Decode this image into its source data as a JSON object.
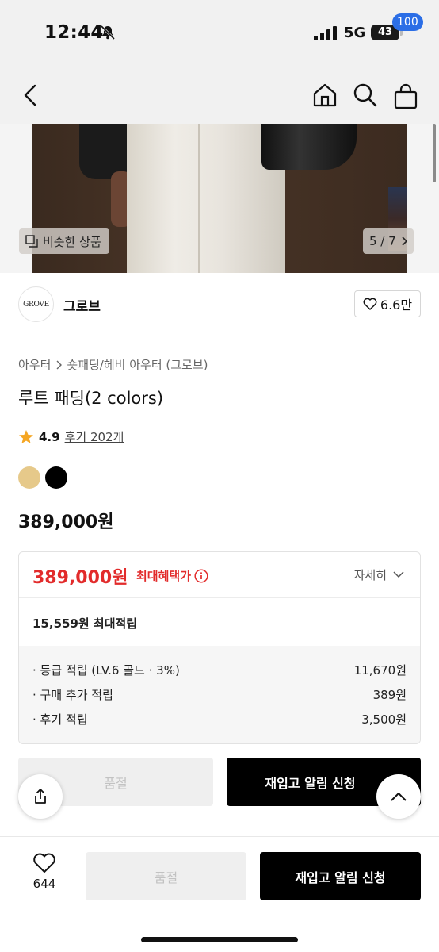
{
  "status_bar": {
    "time": "12:44",
    "network": "5G",
    "battery": "43"
  },
  "nav": {
    "cart_count": "100"
  },
  "hero": {
    "similar_label": "비슷한 상품",
    "page_indicator": "5 / 7"
  },
  "brand": {
    "logo_text": "GROVE",
    "name": "그로브",
    "likes": "6.6만"
  },
  "product": {
    "breadcrumb": [
      "아우터",
      "숏패딩/헤비 아우터 (그로브)"
    ],
    "title": "루트 패딩(2 colors)",
    "rating": "4.9",
    "review_link": "후기 202개",
    "colors": [
      "#e6c98a",
      "#000000"
    ],
    "price": "389,000원"
  },
  "benefit": {
    "price": "389,000원",
    "label": "최대혜택가",
    "detail_label": "자세히",
    "points_total": "15,559원 최대적립",
    "points": [
      {
        "label": "· 등급 적립 (LV.6 골드 · 3%)",
        "value": "11,670원"
      },
      {
        "label": "· 구매 추가 적립",
        "value": "389원"
      },
      {
        "label": "· 후기 적립",
        "value": "3,500원"
      }
    ]
  },
  "actions": {
    "soldout_label": "품절",
    "restock_label": "재입고 알림 신청",
    "like_count": "644"
  }
}
